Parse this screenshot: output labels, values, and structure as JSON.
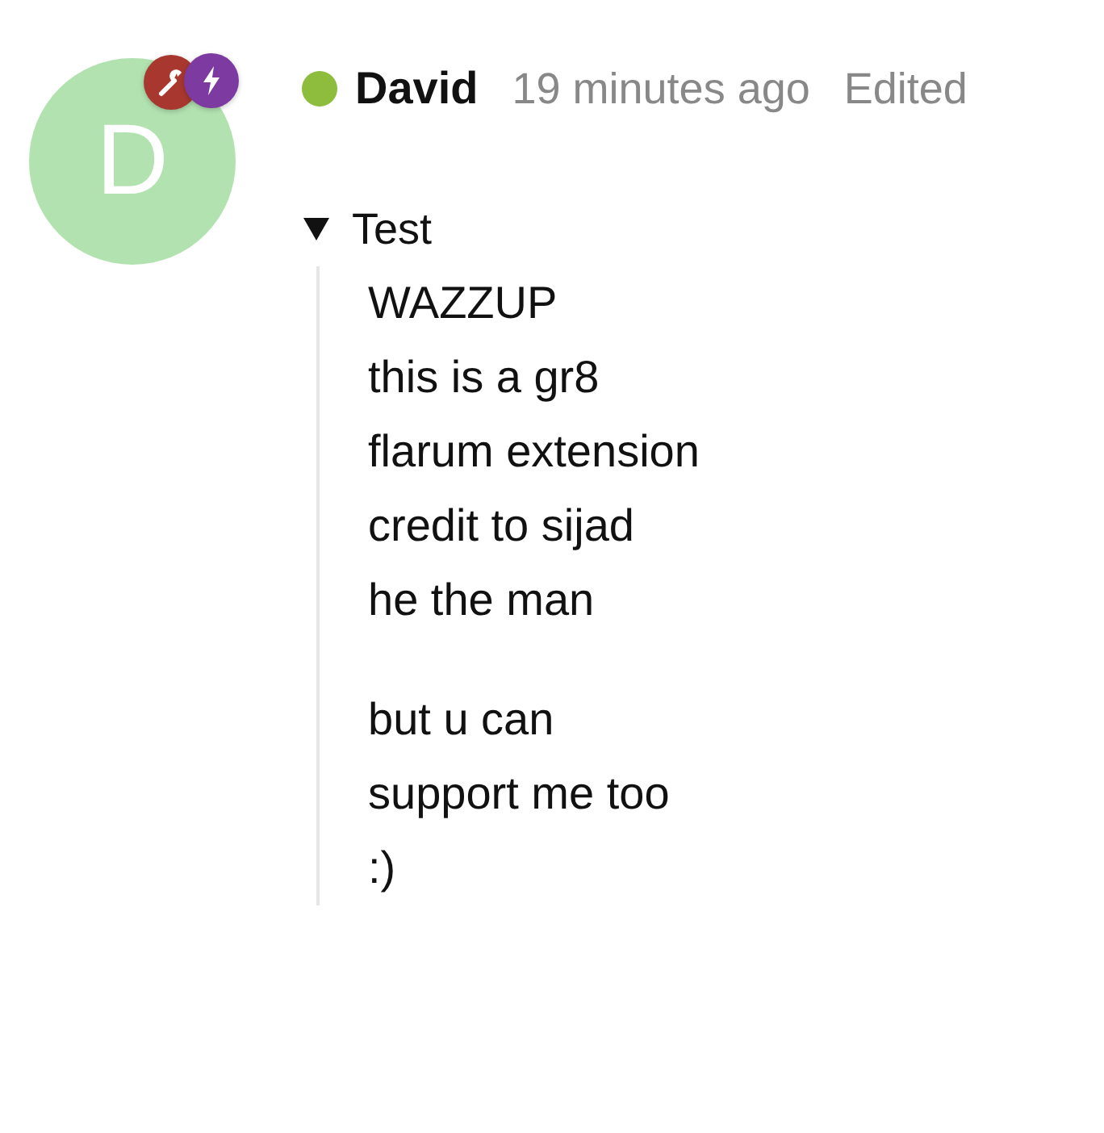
{
  "post": {
    "avatar": {
      "initial": "D"
    },
    "badges": [
      {
        "kind": "wrench",
        "color": "#a8382f"
      },
      {
        "kind": "bolt",
        "color": "#7d3aa0"
      }
    ],
    "author": {
      "name": "David",
      "online": true
    },
    "time": "19 minutes ago",
    "edited": "Edited",
    "spoiler": {
      "summary": "Test",
      "expanded": true,
      "paragraphs": [
        [
          "WAZZUP",
          "this is a gr8",
          "flarum extension",
          "credit to sijad",
          "he the man"
        ],
        [
          "but u can",
          "support me too",
          ":)"
        ]
      ]
    }
  }
}
